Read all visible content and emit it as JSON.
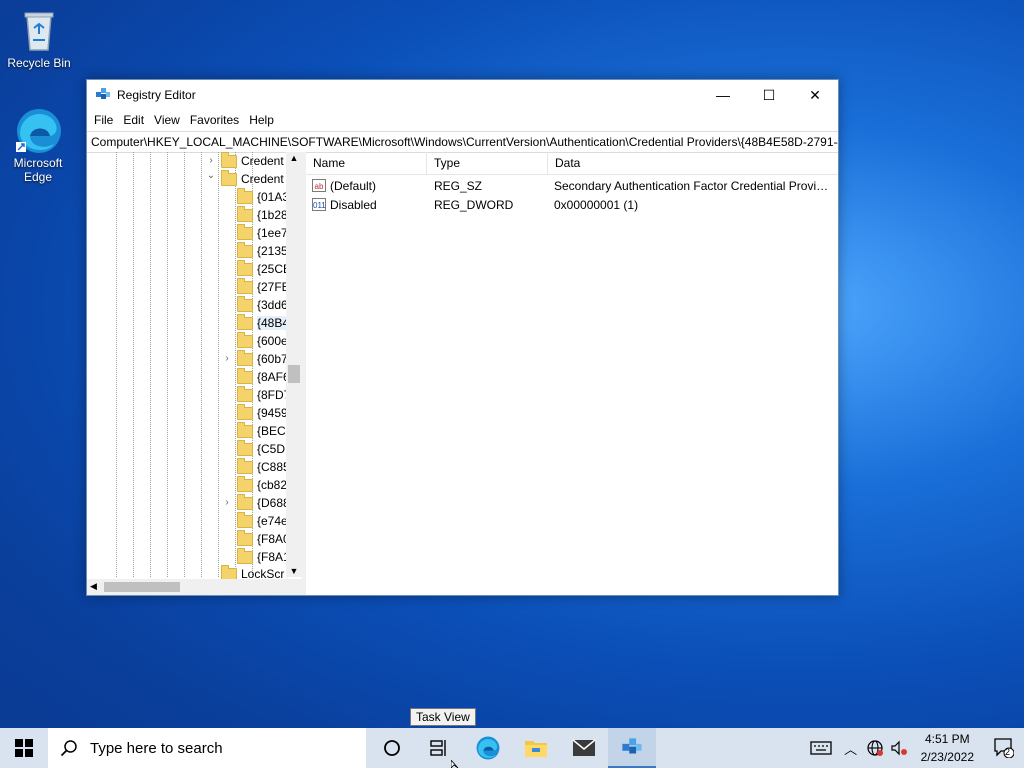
{
  "desktop": {
    "recycle_bin": "Recycle Bin",
    "edge_line1": "Microsoft",
    "edge_line2": "Edge"
  },
  "window": {
    "title": "Registry Editor",
    "minimize": "—",
    "maximize": "☐",
    "close": "✕"
  },
  "menu": [
    "File",
    "Edit",
    "View",
    "Favorites",
    "Help"
  ],
  "address": "Computer\\HKEY_LOCAL_MACHINE\\SOFTWARE\\Microsoft\\Windows\\CurrentVersion\\Authentication\\Credential Providers\\{48B4E58D-2791-4!",
  "tree": {
    "items": [
      {
        "label": "Credent",
        "chevron": "›"
      },
      {
        "label": "Credent",
        "chevron": "⌄"
      },
      {
        "label": "{01A3"
      },
      {
        "label": "{1b28"
      },
      {
        "label": "{1ee7"
      },
      {
        "label": "{2135"
      },
      {
        "label": "{25CE"
      },
      {
        "label": "{27FE"
      },
      {
        "label": "{3dd6"
      },
      {
        "label": "{48B4"
      },
      {
        "label": "{600e"
      },
      {
        "label": "{60b7",
        "chevron": "›"
      },
      {
        "label": "{8AF6"
      },
      {
        "label": "{8FD7"
      },
      {
        "label": "{9459"
      },
      {
        "label": "{BEC0"
      },
      {
        "label": "{C5D"
      },
      {
        "label": "{C885"
      },
      {
        "label": "{cb82"
      },
      {
        "label": "{D688",
        "chevron": "›"
      },
      {
        "label": "{e74e"
      },
      {
        "label": "{F8A0"
      },
      {
        "label": "{F8A1"
      },
      {
        "label": "LockScr"
      }
    ]
  },
  "list": {
    "headers": [
      "Name",
      "Type",
      "Data"
    ],
    "rows": [
      {
        "icon": "ab",
        "name": "(Default)",
        "type": "REG_SZ",
        "data": "Secondary Authentication Factor Credential Provid..."
      },
      {
        "icon": "011",
        "name": "Disabled",
        "type": "REG_DWORD",
        "data": "0x00000001 (1)"
      }
    ]
  },
  "tooltip": "Task View",
  "taskbar": {
    "search_placeholder": "Type here to search",
    "time": "4:51 PM",
    "date": "2/23/2022",
    "notifications": "2"
  }
}
